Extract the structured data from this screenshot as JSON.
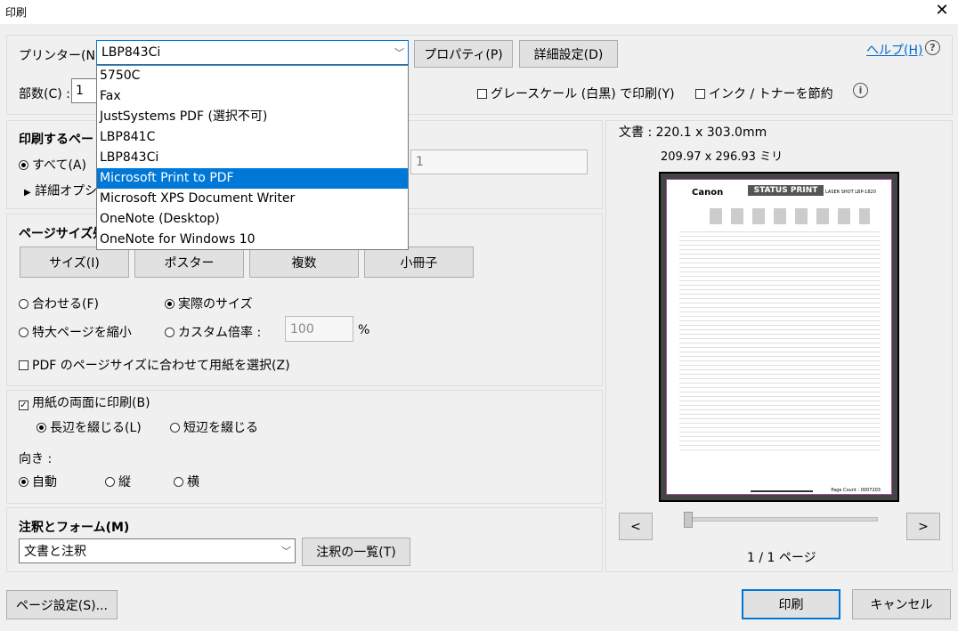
{
  "window": {
    "title": "印刷",
    "close_glyph": "✕"
  },
  "printer": {
    "label": "プリンター(N) :",
    "selected": "LBP843Ci",
    "properties_button": "プロパティ(P)",
    "advanced_button": "詳細設定(D)",
    "help_link": "ヘルプ(H)",
    "help_icon": "?",
    "copies_label": "部数(C) :",
    "copies_value": "1",
    "grayscale_label": "グレースケール (白黒) で印刷(Y)",
    "save_ink_label": "インク / トナーを節約",
    "info_icon": "i",
    "options": [
      "5750C",
      "Fax",
      "JustSystems PDF (選択不可)",
      "LBP841C",
      "LBP843Ci",
      "Microsoft Print to PDF",
      "Microsoft XPS Document Writer",
      "OneNote (Desktop)",
      "OneNote for Windows 10"
    ],
    "highlighted_index": 5
  },
  "pages_to_print": {
    "heading": "印刷するペー",
    "all_label": "すべて(A)",
    "more_options_label": "詳細オプシ",
    "pages_value": "1"
  },
  "page_size": {
    "heading": "ページサイズ処",
    "buttons": [
      "サイズ(I)",
      "ポスター",
      "複数",
      "小冊子"
    ],
    "fit_label": "合わせる(F)",
    "actual_size_label": "実際のサイズ",
    "shrink_label": "特大ページを縮小",
    "custom_scale_label": "カスタム倍率 :",
    "custom_scale_value": "100",
    "percent": "%",
    "choose_paper_label": "PDF のページサイズに合わせて用紙を選択(Z)"
  },
  "duplex": {
    "label": "用紙の両面に印刷(B)",
    "long_edge_label": "長辺を綴じる(L)",
    "short_edge_label": "短辺を綴じる",
    "orientation_label": "向き :",
    "auto_label": "自動",
    "portrait_label": "縦",
    "landscape_label": "横"
  },
  "annotations": {
    "heading": "注釈とフォーム(M)",
    "selected": "文書と注釈",
    "summary_button": "注釈の一覧(T)"
  },
  "preview": {
    "doc_size": "文書 : 220.1 x 303.0mm",
    "mm_size": "209.97 x 296.93 ミリ",
    "prev_glyph": "<",
    "next_glyph": ">",
    "page_indicator": "1 / 1 ページ",
    "page_brand": "Canon",
    "page_heading": "STATUS PRINT",
    "page_model": "LASER SHOT LBP-1820",
    "page_footer": "Page Count : 0007203"
  },
  "footer": {
    "page_setup_button": "ページ設定(S)...",
    "print_button": "印刷",
    "cancel_button": "キャンセル"
  }
}
